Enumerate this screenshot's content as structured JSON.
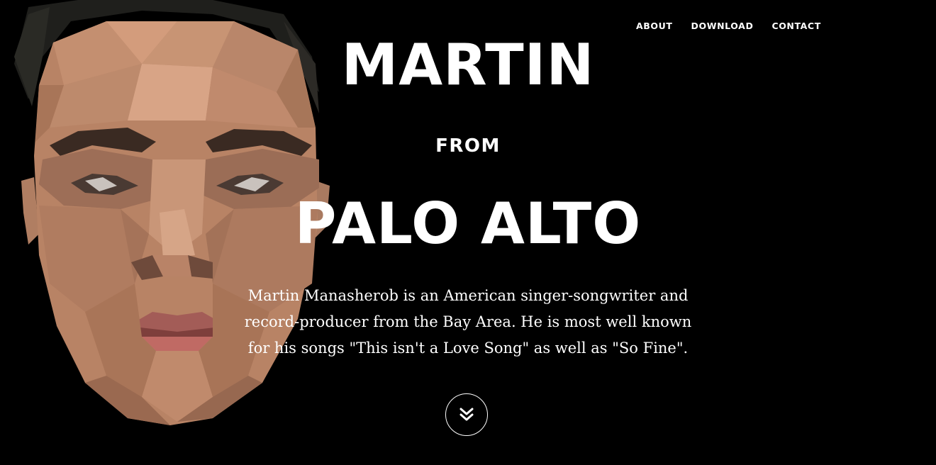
{
  "nav": {
    "items": [
      {
        "label": "ABOUT"
      },
      {
        "label": "DOWNLOAD"
      },
      {
        "label": "CONTACT"
      }
    ]
  },
  "hero": {
    "name": "MARTIN",
    "connector": "FROM",
    "place": "PALO ALTO",
    "bio": "Martin Manasherob is an American singer-songwriter and record-producer from the Bay Area. He is most well known for his songs \"This isn't a Love Song\" as well as \"So Fine\"."
  },
  "scroll_button": {
    "icon": "double-chevron-down-icon"
  },
  "colors": {
    "background": "#000000",
    "text": "#ffffff"
  }
}
